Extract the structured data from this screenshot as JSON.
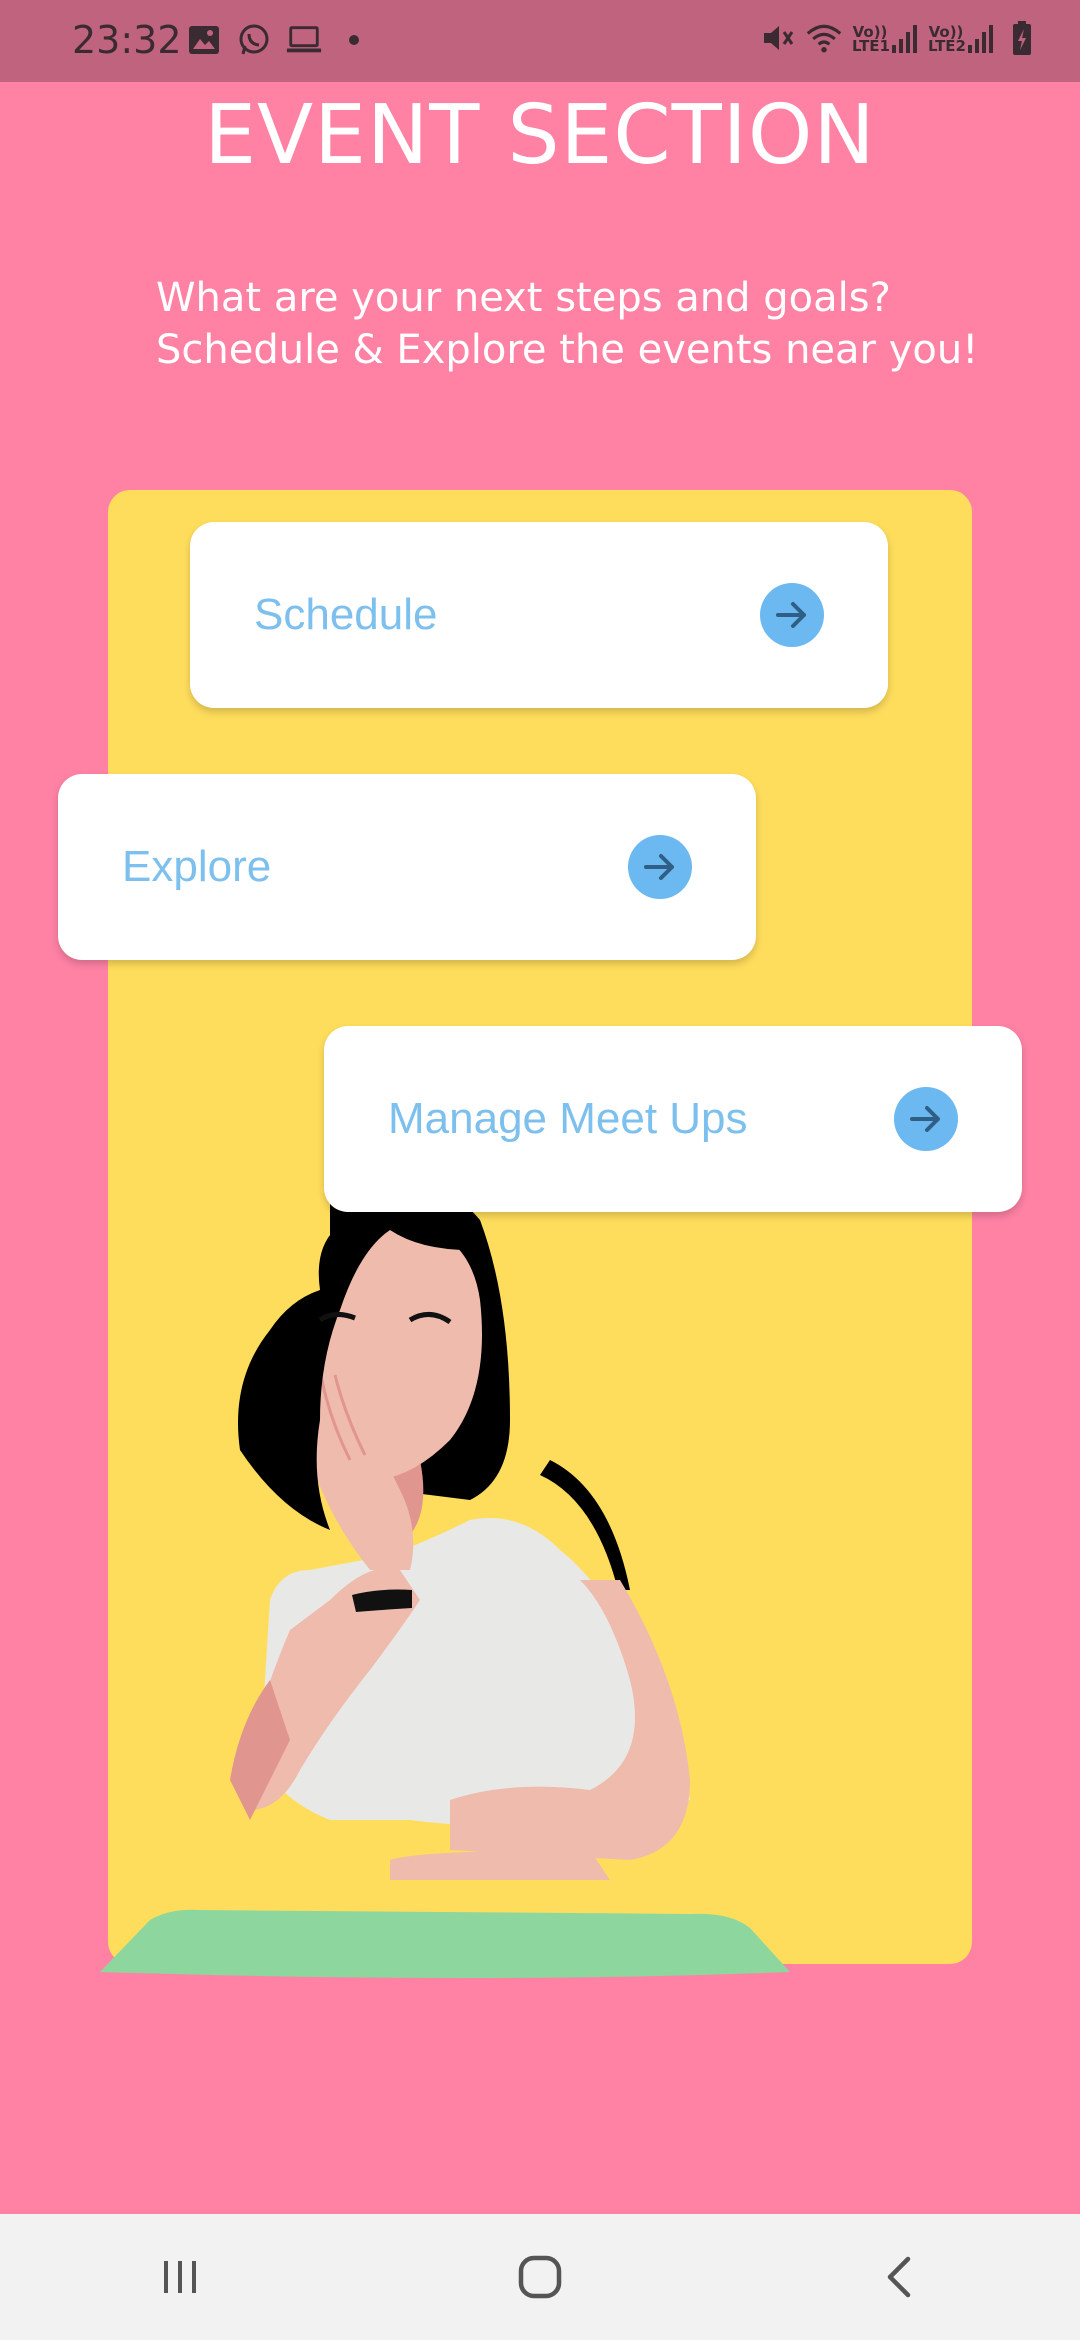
{
  "status_bar": {
    "time": "23:32",
    "left_icons": [
      "image-icon",
      "whatsapp-icon",
      "laptop-icon",
      "dot-icon"
    ],
    "right_icons": [
      "mute-icon",
      "wifi-icon",
      "signal-lte1-icon",
      "signal-lte2-icon",
      "battery-charging-icon"
    ],
    "lte1": "Vo)) LTE1",
    "lte2": "Vo)) LTE2"
  },
  "header": {
    "title": "EVENT SECTION",
    "subtitle_line1": "What are your next steps and goals?",
    "subtitle_line2": "Schedule & Explore the events near you!"
  },
  "cards": [
    {
      "label": "Schedule",
      "icon": "arrow-right-icon"
    },
    {
      "label": "Explore",
      "icon": "arrow-right-icon"
    },
    {
      "label": "Manage Meet Ups",
      "icon": "arrow-right-icon"
    }
  ],
  "nav_bar": {
    "items": [
      "recent-apps-icon",
      "home-icon",
      "back-icon"
    ]
  },
  "colors": {
    "background": "#FF82A5",
    "status_bar": "#C0637E",
    "panel": "#FFDD5C",
    "card": "#FFFFFF",
    "card_text": "#7DC0EE",
    "arrow_button": "#6CB8F0"
  }
}
